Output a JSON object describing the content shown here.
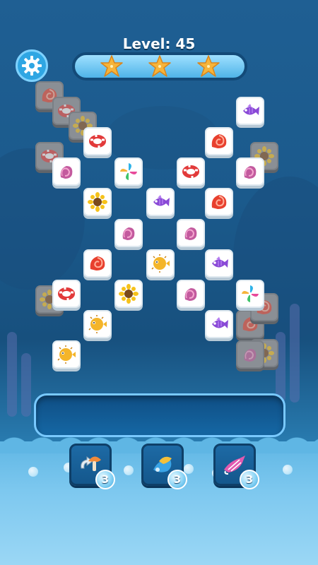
{
  "header": {
    "level_label": "Level: 45",
    "stars_earned": 3,
    "stars_total": 3
  },
  "icons": {
    "settings": "gear-icon",
    "star": "starfish-icon",
    "tile_types": [
      "seashell-icon",
      "life-ring-icon",
      "sunflower-icon",
      "purple-fish-icon",
      "pinwheel-icon",
      "conch-shell-icon",
      "pufferfish-icon"
    ]
  },
  "colors": {
    "accent": "#2fa6e3",
    "star": "#f6b43a",
    "tray": "#0f4e84"
  },
  "board": {
    "tiles": [
      {
        "type": "seashell",
        "dim": true
      },
      {
        "type": "life-ring",
        "dim": true
      },
      {
        "type": "sunflower",
        "dim": true
      },
      {
        "type": "life-ring",
        "dim": false
      },
      {
        "type": "life-ring",
        "dim": true
      },
      {
        "type": "conch",
        "dim": false
      },
      {
        "type": "pinwheel",
        "dim": false
      },
      {
        "type": "sunflower",
        "dim": false
      },
      {
        "type": "conch",
        "dim": false
      },
      {
        "type": "seashell",
        "dim": false
      },
      {
        "type": "pufferfish",
        "dim": false
      },
      {
        "type": "life-ring",
        "dim": false
      },
      {
        "type": "sunflower",
        "dim": false
      },
      {
        "type": "pufferfish",
        "dim": false
      },
      {
        "type": "pufferfish",
        "dim": false
      },
      {
        "type": "sunflower",
        "dim": true
      },
      {
        "type": "purple-fish",
        "dim": false
      },
      {
        "type": "seashell",
        "dim": false
      },
      {
        "type": "purple-fish",
        "dim": false
      },
      {
        "type": "sunflower",
        "dim": true
      },
      {
        "type": "life-ring",
        "dim": false
      },
      {
        "type": "conch",
        "dim": false
      },
      {
        "type": "seashell",
        "dim": false
      },
      {
        "type": "conch",
        "dim": false
      },
      {
        "type": "purple-fish",
        "dim": false
      },
      {
        "type": "conch",
        "dim": false
      },
      {
        "type": "pinwheel",
        "dim": false
      },
      {
        "type": "purple-fish",
        "dim": false
      },
      {
        "type": "seashell",
        "dim": true
      },
      {
        "type": "sunflower",
        "dim": true
      },
      {
        "type": "conch",
        "dim": true
      },
      {
        "type": "seashell",
        "dim": true
      }
    ]
  },
  "slot_tray": {
    "slots_filled": 0
  },
  "boosters": [
    {
      "name": "undo",
      "icon": "mushroom-arrow-icon",
      "count": "3"
    },
    {
      "name": "shuffle",
      "icon": "magic-shell-icon",
      "count": "3"
    },
    {
      "name": "hint",
      "icon": "pink-conch-icon",
      "count": "3"
    }
  ]
}
